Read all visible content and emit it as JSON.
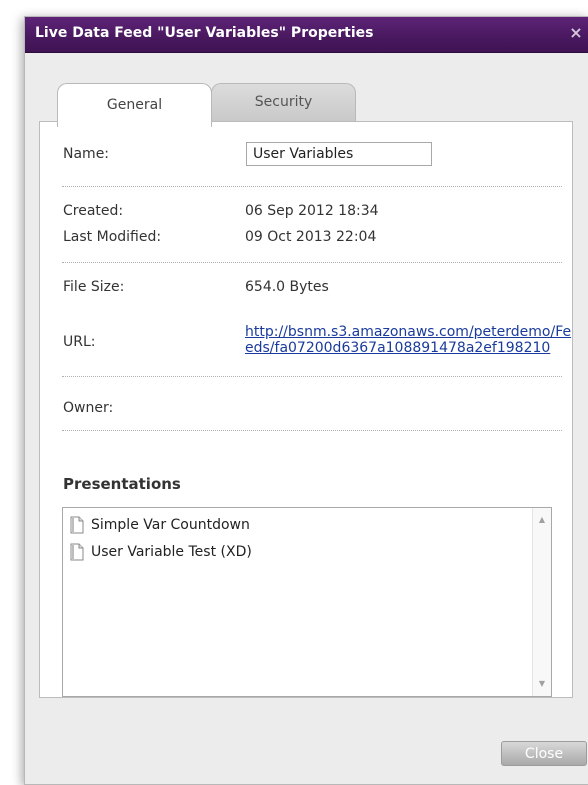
{
  "dialog": {
    "title": "Live Data Feed \"User Variables\" Properties",
    "close_glyph": "×"
  },
  "tabs": [
    {
      "label": "General",
      "active": true
    },
    {
      "label": "Security",
      "active": false
    }
  ],
  "general": {
    "name_label": "Name:",
    "name_value": "User Variables",
    "created_label": "Created:",
    "created_value": "06 Sep 2012 18:34",
    "modified_label": "Last Modified:",
    "modified_value": "09 Oct 2013 22:04",
    "filesize_label": "File Size:",
    "filesize_value": "654.0 Bytes",
    "url_label": "URL:",
    "url_value": "http://bsnm.s3.amazonaws.com/peterdemo/Feeds/fa07200d6367a108891478a2ef198210",
    "owner_label": "Owner:",
    "owner_value": ""
  },
  "presentations": {
    "heading": "Presentations",
    "items": [
      {
        "label": "Simple Var Countdown",
        "icon": "document-icon"
      },
      {
        "label": "User Variable Test (XD)",
        "icon": "document-icon"
      }
    ]
  },
  "footer": {
    "close_label": "Close"
  },
  "colors": {
    "titlebar": "#4a1960",
    "link": "#1a3b9c",
    "button": "#b5b5b5"
  }
}
